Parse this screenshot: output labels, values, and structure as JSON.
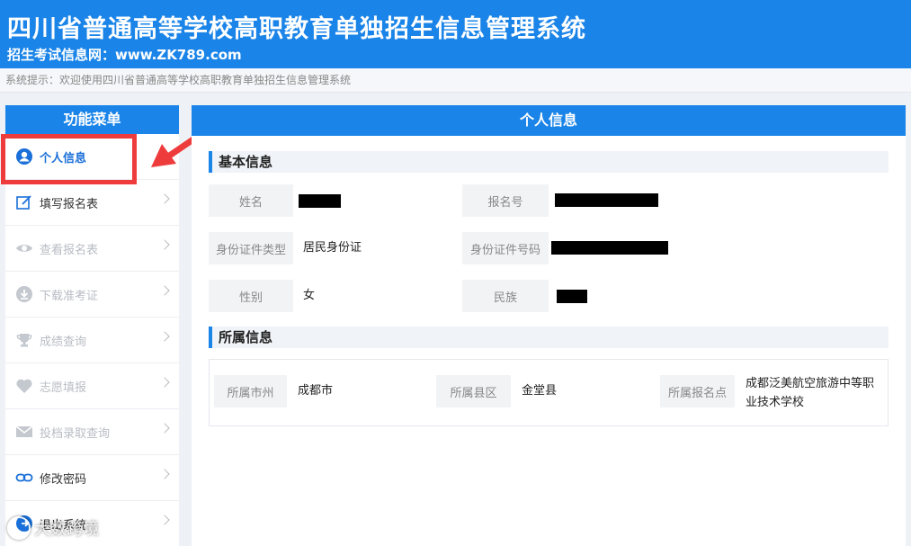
{
  "header": {
    "title": "四川省普通高等学校高职教育单独招生信息管理系统",
    "subtitle": "招生考试信息网：www.ZK789.com"
  },
  "notice": "系统提示：欢迎使用四川省普通高等学校高职教育单独招生信息管理系统",
  "sidebar": {
    "title": "功能菜单",
    "items": [
      {
        "label": "个人信息",
        "icon": "user-icon",
        "state": "active"
      },
      {
        "label": "填写报名表",
        "icon": "edit-icon",
        "state": "enabled"
      },
      {
        "label": "查看报名表",
        "icon": "eye-icon",
        "state": "disabled"
      },
      {
        "label": "下载准考证",
        "icon": "download-icon",
        "state": "disabled"
      },
      {
        "label": "成绩查询",
        "icon": "trophy-icon",
        "state": "disabled"
      },
      {
        "label": "志愿填报",
        "icon": "heart-icon",
        "state": "disabled"
      },
      {
        "label": "投档录取查询",
        "icon": "mail-icon",
        "state": "disabled"
      },
      {
        "label": "修改密码",
        "icon": "link-icon",
        "state": "enabled"
      },
      {
        "label": "退出系统",
        "icon": "logout-icon",
        "state": "enabled"
      }
    ]
  },
  "main": {
    "title": "个人信息",
    "basic": {
      "title": "基本信息",
      "name_label": "姓名",
      "regno_label": "报名号",
      "idtype_label": "身份证件类型",
      "idtype_value": "居民身份证",
      "idno_label": "身份证件号码",
      "gender_label": "性别",
      "gender_value": "女",
      "ethnic_label": "民族"
    },
    "affil": {
      "title": "所属信息",
      "city_label": "所属市州",
      "city_value": "成都市",
      "county_label": "所属县区",
      "county_value": "金堂县",
      "site_label": "所属报名点",
      "site_value": "成都泛美航空旅游中等职业技术学校"
    }
  },
  "watermark": "大数跨境",
  "colors": {
    "primary": "#1a84e8",
    "highlight": "#ee3b3b",
    "disabled": "#b8bcc4"
  }
}
